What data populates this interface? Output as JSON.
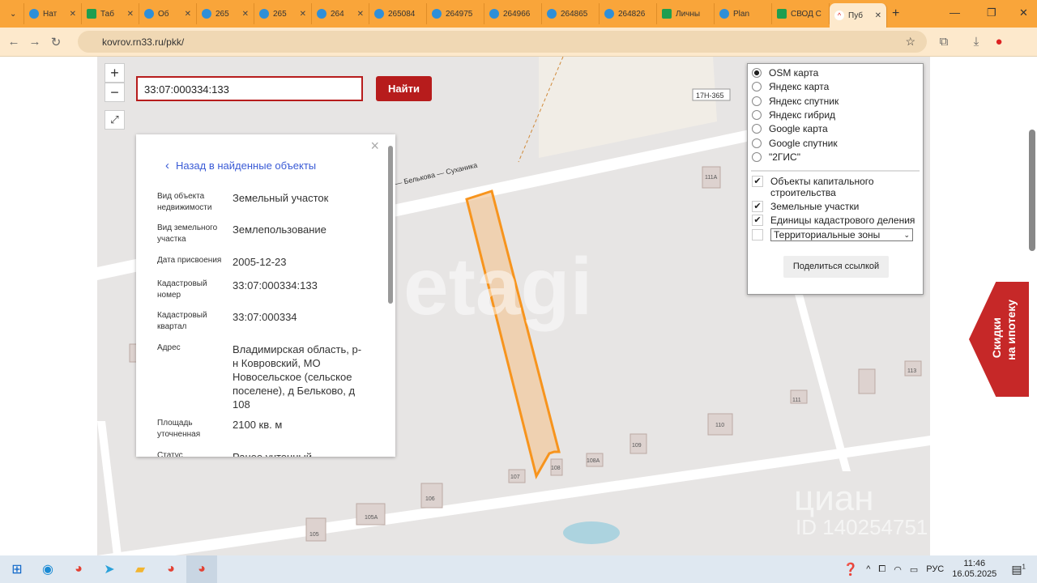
{
  "browser": {
    "tabs": [
      "Нат",
      "Таб",
      "Об",
      "265",
      "265",
      "264",
      "265084",
      "264975",
      "264966",
      "264865",
      "264826",
      "Личны",
      "Plan",
      "СВОД С",
      "Пуб"
    ],
    "url": "kovrov.rn33.ru/pkk/"
  },
  "map": {
    "search_value": "33:07:000334:133",
    "find_label": "Найти",
    "zoom_in": "+",
    "zoom_out": "−",
    "road_label": "— Белькова — Суханика",
    "road_code": "17Н-365",
    "house_labels": [
      "111А",
      "113",
      "111",
      "110",
      "109",
      "108А",
      "108",
      "107",
      "106",
      "105А",
      "105"
    ],
    "watermark": "etagi",
    "watermark2": "циан",
    "watermark3": "ID 140254751"
  },
  "info": {
    "back": "Назад в найденные объекты",
    "close": "×",
    "rows": [
      {
        "k": "Вид объекта недвижимости",
        "v": "Земельный участок"
      },
      {
        "k": "Вид земельного участка",
        "v": "Землепользование"
      },
      {
        "k": "Дата присвоения",
        "v": "2005-12-23"
      },
      {
        "k": "Кадастровый номер",
        "v": "33:07:000334:133"
      },
      {
        "k": "Кадастровый квартал",
        "v": "33:07:000334"
      },
      {
        "k": "Адрес",
        "v": "Владимирская область, р-н Ковровский, МО Новосельское (сельское поселене), д Бельково, д 108"
      },
      {
        "k": "Площадь уточненная",
        "v": "2100 кв. м"
      },
      {
        "k": "Статус",
        "v": "Ранее учтенный"
      }
    ]
  },
  "layers": {
    "base": [
      "OSM карта",
      "Яндекс карта",
      "Яндекс спутник",
      "Яндекс гибрид",
      "Google карта",
      "Google спутник",
      "\"2ГИС\""
    ],
    "overlays": [
      "Объекты капитального строительства",
      "Земельные участки",
      "Единицы кадастрового деления"
    ],
    "zones_select": "Территориальные зоны",
    "share": "Поделиться ссылкой"
  },
  "promo": {
    "text1": "Скидки",
    "text2": "на ипотеку"
  },
  "taskbar": {
    "lang": "РУС",
    "time": "11:46",
    "date": "16.05.2025",
    "notif": "1"
  },
  "colors": {
    "accent": "#b71c1c",
    "parcel": "#f7941d",
    "tabbar": "#f9a53a"
  }
}
